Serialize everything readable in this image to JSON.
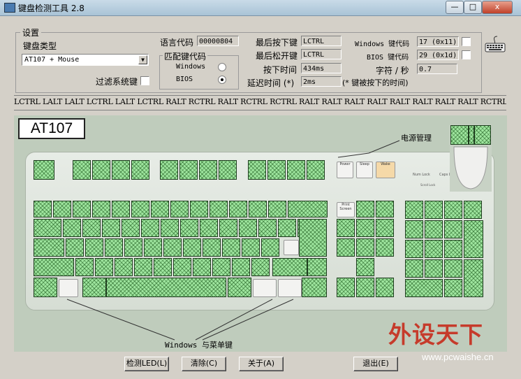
{
  "window": {
    "title": "键盘检测工具 2.8",
    "minimize_glyph": "—",
    "maximize_glyph": "□",
    "close_glyph": "x"
  },
  "settings": {
    "group_title": "设置",
    "keyboard_type_label": "键盘类型",
    "keyboard_type_value": "AT107 + Mouse",
    "filter_label": "过滤系统键",
    "lang_code_label": "语言代码",
    "lang_code_value": "00000804",
    "match_group_title": "匹配键代码",
    "windows_label": "Windows",
    "bios_label": "BIOS",
    "last_pressed_label": "最后按下键",
    "last_pressed_value": "LCTRL",
    "last_released_label": "最后松开键",
    "last_released_value": "LCTRL",
    "press_time_label": "按下时间",
    "press_time_value": "434ms",
    "delay_label": "延迟时间 (*)",
    "delay_value": "2ms",
    "delay_note": "(* 键被按下的时间)",
    "win_code_label": "Windows 键代码",
    "win_code_value": "17 (0x11)",
    "bios_code_label": "BIOS 键代码",
    "bios_code_value": "29 (0x1d)",
    "cps_label": "字符 / 秒",
    "cps_value": "0.7"
  },
  "key_log": "LCTRL LALT LALT LCTRL LALT LCTRL RALT RCTRL RALT RCTRL RCTRL RALT RALT RALT RALT RALT RALT RALT RALT RCTRL RCTRL RCTRL",
  "keyboard": {
    "model": "AT107",
    "power_caption": "电源管理",
    "win_menu_caption": "Windows 与菜单键",
    "power_keys": [
      "Power",
      "Sleep",
      "Wake"
    ],
    "leds": [
      "Num Lock",
      "Caps Lock",
      "Scroll Lock"
    ],
    "print_screen": "Print Screen"
  },
  "buttons": {
    "check_led": "检测LED(L)",
    "clear": "清除(C)",
    "about": "关于(A)",
    "exit": "退出(E)"
  },
  "watermark": {
    "brand": "外设天下",
    "url": "www.pcwaishe.cn"
  },
  "colors": {
    "tested_key": "#9fe69f",
    "pressed_key": "#f5d9a8",
    "keyboard_bg": "#bfccbc"
  }
}
